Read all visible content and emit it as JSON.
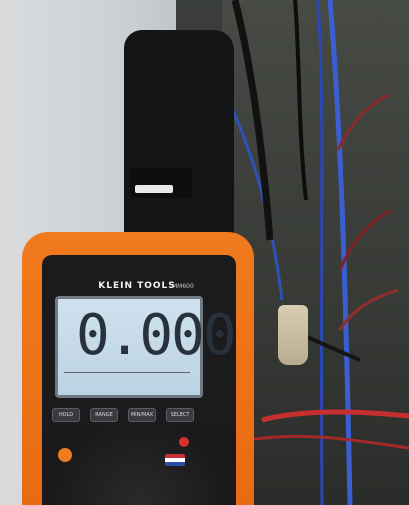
{
  "meter": {
    "brand": "KLEIN TOOLS",
    "model": "MM600",
    "reading": "0.000",
    "buttons": [
      "HOLD",
      "RANGE",
      "MIN/MAX",
      "SELECT"
    ]
  }
}
